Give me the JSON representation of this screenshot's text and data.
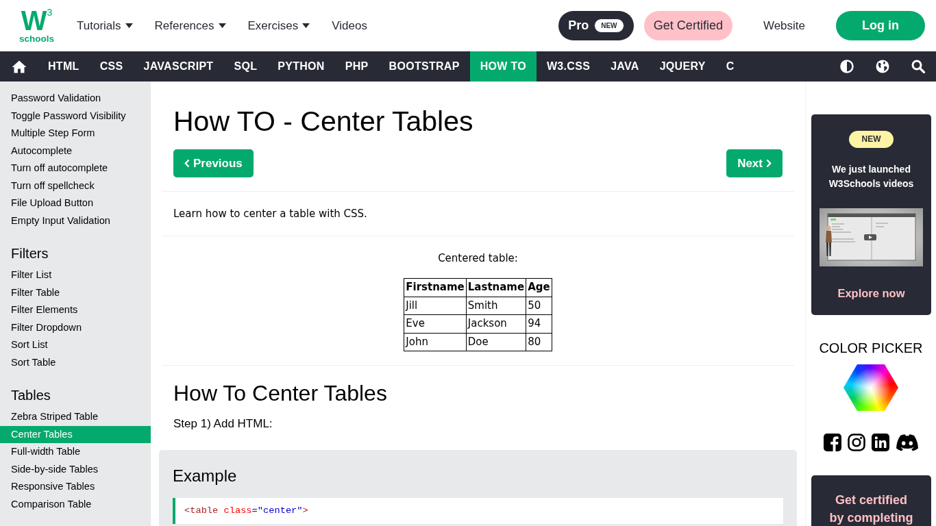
{
  "logo": {
    "mark": "W",
    "superscript": "3",
    "wordmark": "schools"
  },
  "header": {
    "nav_links": [
      {
        "label": "Tutorials",
        "kind": "dropdown"
      },
      {
        "label": "References",
        "kind": "dropdown"
      },
      {
        "label": "Exercises",
        "kind": "dropdown"
      },
      {
        "label": "Videos",
        "kind": "link"
      }
    ],
    "pro_button": {
      "label": "Pro",
      "badge": "NEW"
    },
    "certified_button": "Get Certified",
    "website_link": "Website",
    "login_button": "Log in"
  },
  "topnav": {
    "items": [
      {
        "label": "HTML",
        "selected": false
      },
      {
        "label": "CSS",
        "selected": false
      },
      {
        "label": "JAVASCRIPT",
        "selected": false
      },
      {
        "label": "SQL",
        "selected": false
      },
      {
        "label": "PYTHON",
        "selected": false
      },
      {
        "label": "PHP",
        "selected": false
      },
      {
        "label": "BOOTSTRAP",
        "selected": false
      },
      {
        "label": "HOW TO",
        "selected": true
      },
      {
        "label": "W3.CSS",
        "selected": false
      },
      {
        "label": "JAVA",
        "selected": false
      },
      {
        "label": "JQUERY",
        "selected": false
      },
      {
        "label": "C",
        "selected": false
      }
    ]
  },
  "sidebar": {
    "sections": [
      {
        "items": [
          {
            "label": "Password Validation",
            "selected": false
          },
          {
            "label": "Toggle Password Visibility",
            "selected": false
          },
          {
            "label": "Multiple Step Form",
            "selected": false
          },
          {
            "label": "Autocomplete",
            "selected": false
          },
          {
            "label": "Turn off autocomplete",
            "selected": false
          },
          {
            "label": "Turn off spellcheck",
            "selected": false
          },
          {
            "label": "File Upload Button",
            "selected": false
          },
          {
            "label": "Empty Input Validation",
            "selected": false
          }
        ]
      },
      {
        "heading": "Filters",
        "items": [
          {
            "label": "Filter List",
            "selected": false
          },
          {
            "label": "Filter Table",
            "selected": false
          },
          {
            "label": "Filter Elements",
            "selected": false
          },
          {
            "label": "Filter Dropdown",
            "selected": false
          },
          {
            "label": "Sort List",
            "selected": false
          },
          {
            "label": "Sort Table",
            "selected": false
          }
        ]
      },
      {
        "heading": "Tables",
        "items": [
          {
            "label": "Zebra Striped Table",
            "selected": false
          },
          {
            "label": "Center Tables",
            "selected": true
          },
          {
            "label": "Full-width Table",
            "selected": false
          },
          {
            "label": "Side-by-side Tables",
            "selected": false
          },
          {
            "label": "Responsive Tables",
            "selected": false
          },
          {
            "label": "Comparison Table",
            "selected": false
          }
        ]
      }
    ]
  },
  "main": {
    "title": "How TO - Center Tables",
    "previous_button": "Previous",
    "next_button": "Next",
    "intro": "Learn how to center a table with CSS.",
    "demo": {
      "caption": "Centered table:",
      "columns": [
        "Firstname",
        "Lastname",
        "Age"
      ],
      "rows": [
        [
          "Jill",
          "Smith",
          "50"
        ],
        [
          "Eve",
          "Jackson",
          "94"
        ],
        [
          "John",
          "Doe",
          "80"
        ]
      ]
    },
    "heading": "How To Center Tables",
    "step": "Step 1) Add HTML:",
    "example": {
      "heading": "Example",
      "code_lines": [
        [
          {
            "kind": "tag",
            "text": "<table"
          },
          {
            "kind": "attr",
            "text": " class"
          },
          {
            "kind": "value",
            "text": "=\"center\""
          },
          {
            "kind": "tag",
            "text": ">"
          }
        ]
      ]
    }
  },
  "aside": {
    "promo": {
      "badge": "NEW",
      "text": "We just launched W3Schools videos",
      "link": "Explore now"
    },
    "color_picker": {
      "heading": "COLOR PICKER"
    },
    "certificate": {
      "text": "Get certified by completing"
    }
  }
}
